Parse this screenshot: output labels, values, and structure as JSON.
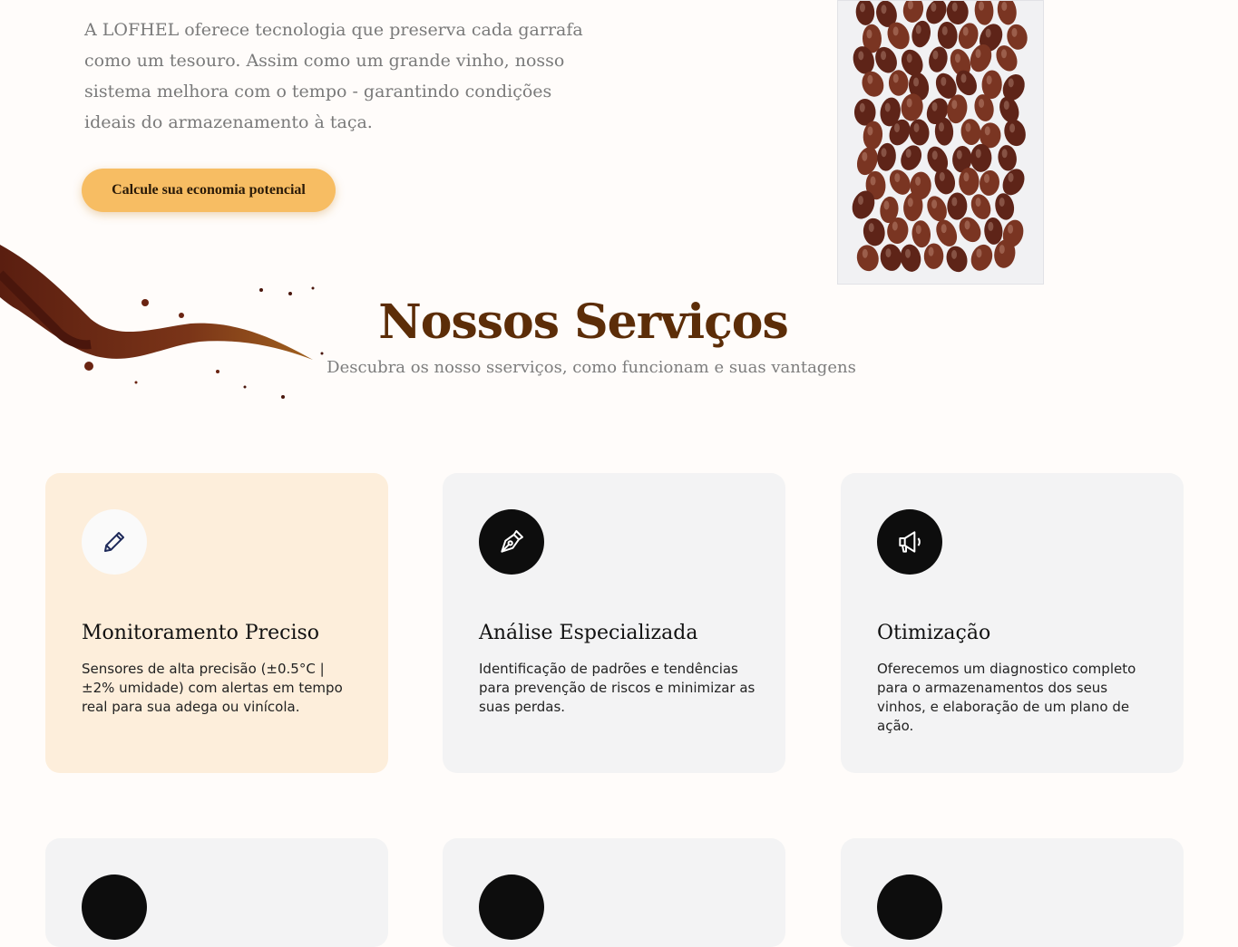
{
  "hero": {
    "text": "A LOFHEL oferece tecnologia que preserva cada garrafa como um tesouro. Assim como um grande vinho, nosso sistema melhora com o tempo - garantindo condições ideais do armazenamento à taça.",
    "cta_label": "Calcule sua economia potencial"
  },
  "services": {
    "title": "Nossos Serviços",
    "subtitle": "Descubra os nosso sserviços, como funcionam e suas vantagens",
    "cards": [
      {
        "icon": "pencil-icon",
        "title": "Monitoramento Preciso",
        "text": "Sensores de alta precisão (±0.5°C | ±2% umidade) com alertas em tempo real para sua adega ou vinícola."
      },
      {
        "icon": "pen-nib-icon",
        "title": "Análise Especializada",
        "text": "Identificação de padrões e tendências para prevenção de riscos e minimizar as suas perdas."
      },
      {
        "icon": "megaphone-icon",
        "title": "Otimização",
        "text": "Oferecemos um diagnostico completo para o armazenamentos dos seus vinhos, e elaboração de um plano de ação."
      }
    ]
  },
  "colors": {
    "accent": "#f7bd63",
    "title_brown": "#5c2d08",
    "card_highlight": "#fdeedb",
    "card_default": "#f3f3f4"
  }
}
